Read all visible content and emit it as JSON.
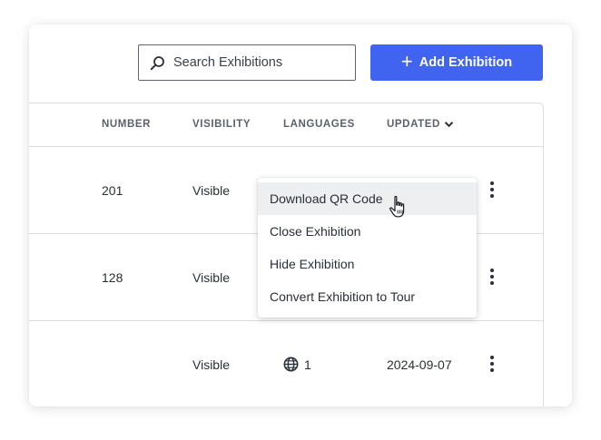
{
  "toolbar": {
    "search_placeholder": "Search Exhibitions",
    "add_button_label": "Add Exhibition",
    "accent_color": "#4063f0"
  },
  "table": {
    "columns": [
      "NUMBER",
      "VISIBILITY",
      "LANGUAGES",
      "UPDATED"
    ],
    "sort_column": "UPDATED",
    "sort_direction": "descending",
    "rows": [
      {
        "number": "201",
        "visibility": "Visible",
        "languages": "",
        "updated": ""
      },
      {
        "number": "128",
        "visibility": "Visible",
        "languages": "",
        "updated": ""
      },
      {
        "number": "",
        "visibility": "Visible",
        "languages": "1",
        "updated": "2024-09-07"
      }
    ]
  },
  "context_menu": {
    "items": [
      "Download QR Code",
      "Close Exhibition",
      "Hide Exhibition",
      "Convert Exhibition to Tour"
    ],
    "hovered_item": "Download QR Code"
  },
  "icons": {
    "search": "search-icon",
    "add": "plus-icon",
    "sort": "chevron-down-icon",
    "row_actions": "kebab-menu-icon",
    "languages": "globe-icon",
    "cursor": "hand-pointer-cursor"
  }
}
